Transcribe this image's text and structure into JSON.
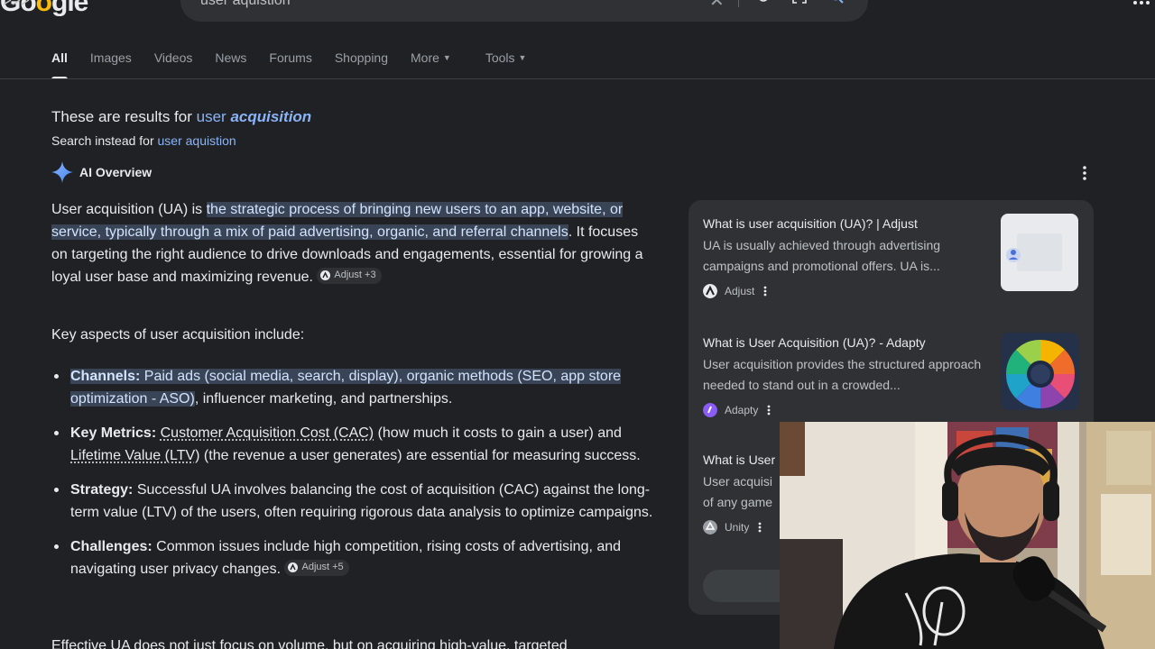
{
  "logo": {
    "text_start": "Go",
    "text_mid": "o",
    "text_end": "gle"
  },
  "search": {
    "query": "user aquistion"
  },
  "tabs": [
    {
      "label": "All"
    },
    {
      "label": "Images"
    },
    {
      "label": "Videos"
    },
    {
      "label": "News"
    },
    {
      "label": "Forums"
    },
    {
      "label": "Shopping"
    },
    {
      "label": "More"
    },
    {
      "label": "Tools"
    }
  ],
  "spelling": {
    "prefix": "These are results for",
    "corrected_plain": "user",
    "corrected_emph": "acquisition",
    "instead_prefix": "Search instead for",
    "instead_query": "user aquistion"
  },
  "ai_overview": {
    "title": "AI Overview",
    "intro_lead": "User acquisition (UA) is",
    "intro_highlight": "the strategic process of bringing new users to an app, website, or service, typically through a mix of paid advertising, organic, and referral channels",
    "intro_rest": ". It focuses on targeting the right audience to drive downloads and engagements, essential for growing a loyal user base and maximizing revenue.",
    "intro_chip": "Adjust +3",
    "aspects_heading": "Key aspects of user acquisition include:",
    "bullets": [
      {
        "label": "Channels:",
        "text_highlight": "Paid ads (social media, search, display), organic methods (SEO, app store optimization - ASO)",
        "text": ", influencer marketing, and partnerships."
      },
      {
        "label": "Key Metrics:",
        "link1": "Customer Acquisition Cost (CAC)",
        "text1": " (how much it costs to gain a user) and ",
        "link2": "Lifetime Value (LTV)",
        "text2": " (the revenue a user generates) are essential for measuring success."
      },
      {
        "label": "Strategy:",
        "text": "Successful UA involves balancing the cost of acquisition (CAC) against the long-term value (LTV) of the users, often requiring rigorous data analysis to optimize campaigns."
      },
      {
        "label": "Challenges:",
        "text": "Common issues include high competition, rising costs of advertising, and navigating user privacy changes.",
        "chip": "Adjust +5"
      }
    ],
    "cutoff": "Effective UA does not just focus on volume, but on acquiring high-value, targeted"
  },
  "sources": [
    {
      "title": "What is user acquisition (UA)? | Adjust",
      "snippet": "UA is usually achieved through advertising campaigns and promotional offers. UA is...",
      "source": "Adjust"
    },
    {
      "title": "What is User Acquisition (UA)? - Adapty",
      "snippet": "User acquisition provides the structured approach needed to stand out in a crowded...",
      "source": "Adapty"
    },
    {
      "title": "What is User",
      "snippet": "User acquisi of any game",
      "source": "Unity"
    }
  ],
  "colors": {
    "background": "#202124",
    "panel": "#303134",
    "link": "#8ab4f8",
    "highlight": "#394457"
  }
}
